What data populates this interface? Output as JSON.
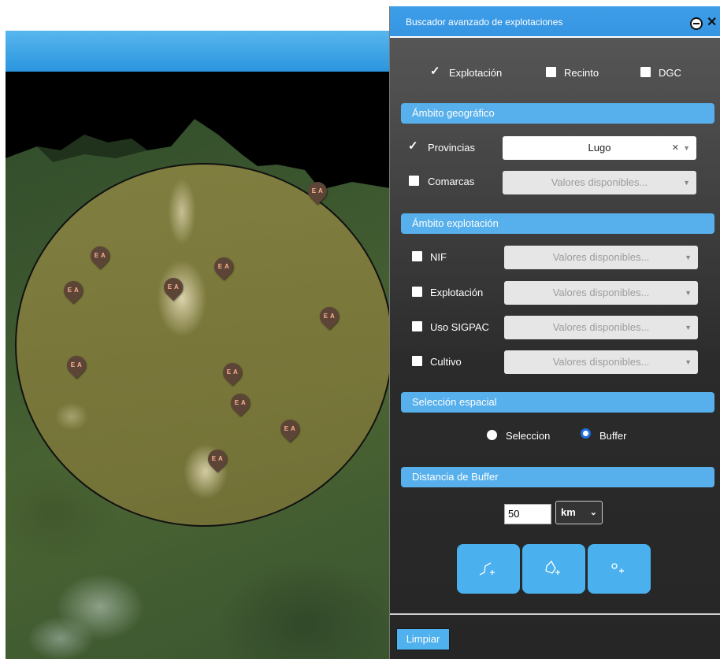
{
  "map": {
    "pins": [
      "E A",
      "E A",
      "E A",
      "E A",
      "E A",
      "E A",
      "E A",
      "E A",
      "E A",
      "E A",
      "E A"
    ]
  },
  "panel": {
    "title": "Buscador avanzado de explotaciones",
    "search_types": [
      {
        "label": "Explotación",
        "checked": true
      },
      {
        "label": "Recinto",
        "checked": false
      },
      {
        "label": "DGC",
        "checked": false
      }
    ],
    "geo": {
      "header": "Ámbito geográfico",
      "rows": [
        {
          "label": "Provincias",
          "checked": true,
          "value": "Lugo"
        },
        {
          "label": "Comarcas",
          "checked": false,
          "placeholder": "Valores disponibles..."
        }
      ]
    },
    "exploitation": {
      "header": "Ámbito explotación",
      "rows": [
        {
          "label": "NIF",
          "checked": false,
          "placeholder": "Valores disponibles..."
        },
        {
          "label": "Explotación",
          "checked": false,
          "placeholder": "Valores disponibles..."
        },
        {
          "label": "Uso SIGPAC",
          "checked": false,
          "placeholder": "Valores disponibles..."
        },
        {
          "label": "Cultivo",
          "checked": false,
          "placeholder": "Valores disponibles..."
        }
      ]
    },
    "spatial": {
      "header": "Selección espacial",
      "options": [
        {
          "label": "Seleccion",
          "selected": false
        },
        {
          "label": "Buffer",
          "selected": true
        }
      ]
    },
    "buffer": {
      "header": "Distancia de Buffer",
      "value": "50",
      "unit": "km"
    },
    "tools": [
      "draw-line-icon",
      "draw-polygon-icon",
      "draw-point-icon"
    ],
    "clear_label": "Limpiar"
  },
  "colors": {
    "accent": "#57b0ec",
    "panel_bg": "#2b2b2b",
    "pin": "#5c4437",
    "radio_on": "#1f6fe0"
  }
}
